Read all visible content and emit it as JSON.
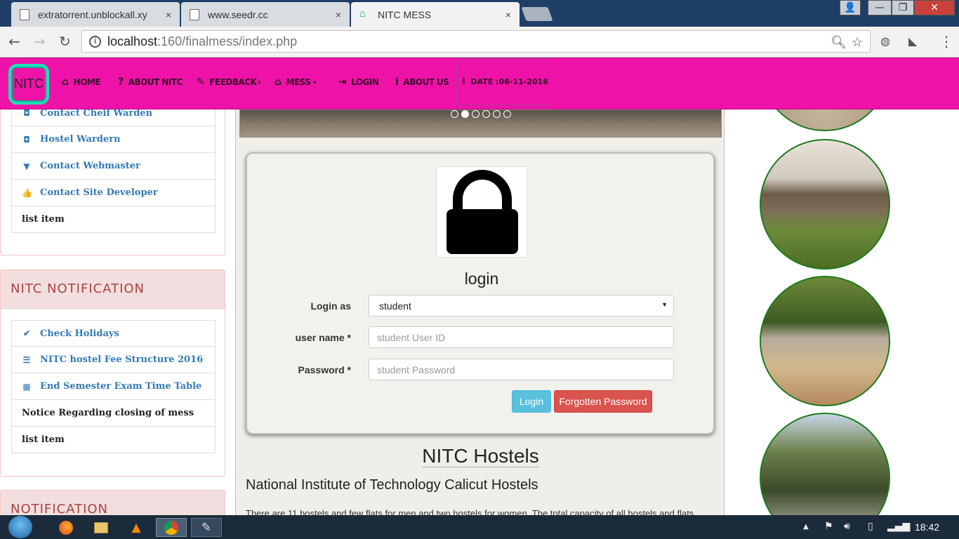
{
  "browser": {
    "tabs": [
      {
        "title": "extratorrent.unblockall.xy",
        "close": "×"
      },
      {
        "title": "www.seedr.cc",
        "close": "×"
      },
      {
        "title": "NITC MESS",
        "close": "×"
      }
    ],
    "url_host": "localhost",
    "url_path": ":160/finalmess/index.php",
    "window_buttons": {
      "minimize": "—",
      "maximize": "❐",
      "close": "✕"
    }
  },
  "navbar": {
    "brand": "NITC",
    "items": [
      {
        "label": "HOME",
        "icon": "home-icon",
        "glyph": "⌂"
      },
      {
        "label": "ABOUT NITC",
        "icon": "question-circle-icon",
        "glyph": "?"
      },
      {
        "label": "FEEDBACK",
        "icon": "pencil-icon",
        "glyph": "✎"
      },
      {
        "label": "MESS",
        "icon": "home-icon",
        "glyph": "⌂"
      },
      {
        "label": "LOGIN",
        "icon": "login-icon",
        "glyph": "⇥"
      },
      {
        "label": "ABOUT US",
        "icon": "info-circle-icon",
        "glyph": "i"
      }
    ],
    "date": {
      "label": "DATE :06-11-2016",
      "icon": "info-circle-icon",
      "glyph": "i"
    }
  },
  "sidebar": {
    "top_panel": {
      "items": [
        {
          "label": "Contact Cheif Warden",
          "icon": "camera-icon",
          "glyph": "◘"
        },
        {
          "label": "Hostel Wardern",
          "icon": "camera-icon",
          "glyph": "◘"
        },
        {
          "label": "Contact Webmaster",
          "icon": "triangle-down-icon",
          "glyph": "▼"
        },
        {
          "label": "Contact Site Developer",
          "icon": "thumbs-up-icon",
          "glyph": "👍"
        },
        {
          "label": "list item",
          "icon": "",
          "glyph": ""
        }
      ]
    },
    "notification_panel": {
      "title": "NITC NOTIFICATION",
      "items": [
        {
          "label": "Check Holidays",
          "icon": "check-icon",
          "glyph": "✔"
        },
        {
          "label": "NITC hostel Fee Structure 2016",
          "icon": "list-icon",
          "glyph": "☰"
        },
        {
          "label": "End Semester Exam Time Table",
          "icon": "calendar-icon",
          "glyph": "▦"
        },
        {
          "label": "Notice Regarding closing of mess",
          "icon": "",
          "glyph": ""
        },
        {
          "label": "list item",
          "icon": "",
          "glyph": ""
        }
      ]
    },
    "bottom_panel": {
      "title": "NOTIFICATION"
    }
  },
  "login": {
    "title": "login",
    "login_as_label": "Login as",
    "login_as_value": "student",
    "username_label": "user name *",
    "username_placeholder": "student User ID",
    "password_label": "Password *",
    "password_placeholder": "student Password",
    "login_button": "Login",
    "forgot_button": "Forgotten Password",
    "lock_icon": "lock-icon"
  },
  "carousel": {
    "slide_count": 6,
    "active_index": 1
  },
  "content": {
    "title": "NITC Hostels",
    "subtitle": "National Institute of Technology Calicut Hostels",
    "text": "There are 11 hostels and few flats for men and two hostels for women. The total capacity of all hostels and flats"
  },
  "taskbar": {
    "clock": "18:42",
    "apps": [
      "firefox-icon",
      "file-explorer-icon",
      "vlc-icon",
      "chrome-icon",
      "paint-icon"
    ]
  },
  "colors": {
    "navbar": "#ee12a8",
    "panel_heading": "#f2dede",
    "heading_text": "#a94442",
    "link": "#337ab7"
  }
}
